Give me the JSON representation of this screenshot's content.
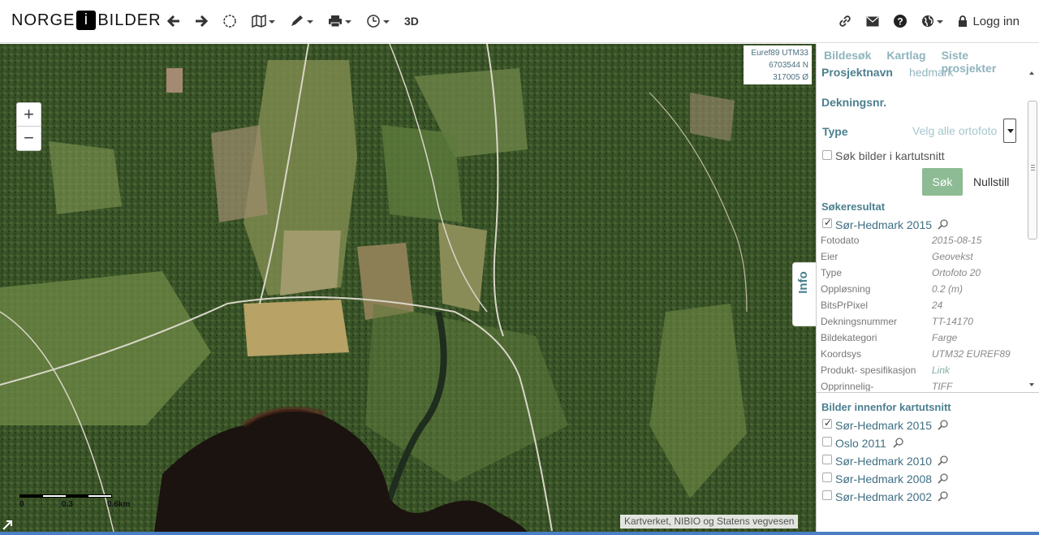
{
  "logo": {
    "left": "NORGE",
    "i": "i",
    "right": "BILDER"
  },
  "toolbar": {
    "back_icon": "arrow-left-icon",
    "forward_icon": "arrow-right-icon",
    "extent_icon": "circle-icon",
    "map_icon": "map-icon",
    "draw_icon": "pencil-icon",
    "print_icon": "printer-icon",
    "history_icon": "clock-icon",
    "three_d": "3D"
  },
  "header_right": {
    "link_icon": "link-icon",
    "mail_icon": "envelope-icon",
    "help_icon": "question-icon",
    "globe_icon": "globe-icon",
    "login_label": "Logg inn"
  },
  "map": {
    "coord_system": "Euref89 UTM33",
    "north": "6703544 N",
    "east": "317005 Ø",
    "scale_labels": [
      "0",
      "0.3",
      "0.6km"
    ],
    "attribution": "Kartverket, NIBIO og Statens vegvesen",
    "zoom_in": "+",
    "zoom_out": "−",
    "info_tab": "Info"
  },
  "panel": {
    "tabs": [
      "Bildesøk",
      "Kartlag",
      "Siste prosjekter"
    ],
    "project_label": "Prosjektnavn",
    "project_value": "hedmark",
    "coverage_label": "Dekningsnr.",
    "type_label": "Type",
    "type_placeholder": "Velg alle ortofoto",
    "search_in_view": "Søk bilder i kartutsnitt",
    "search_button": "Søk",
    "reset_button": "Nullstill",
    "results_heading": "Søkeresultat",
    "result_title": "Sør-Hedmark 2015",
    "metadata": [
      {
        "key": "Fotodato",
        "value": "2015-08-15"
      },
      {
        "key": "Eier",
        "value": "Geovekst"
      },
      {
        "key": "Type",
        "value": "Ortofoto 20"
      },
      {
        "key": "Oppløsning",
        "value": "0.2 (m)"
      },
      {
        "key": "BitsPrPixel",
        "value": "24"
      },
      {
        "key": "Dekningsnummer",
        "value": "TT-14170"
      },
      {
        "key": "Bildekategori",
        "value": "Farge"
      },
      {
        "key": "Koordsys",
        "value": "UTM32 EUREF89"
      },
      {
        "key": "Produkt- spesifikasjon",
        "value": "Link"
      },
      {
        "key": "Opprinnelig-",
        "value": "TIFF"
      }
    ],
    "in_view_heading": "Bilder innenfor kartutsnitt",
    "in_view": [
      {
        "label": "Sør-Hedmark 2015",
        "checked": true
      },
      {
        "label": "Oslo 2011",
        "checked": false
      },
      {
        "label": "Sør-Hedmark 2010",
        "checked": false
      },
      {
        "label": "Sør-Hedmark 2008",
        "checked": false
      },
      {
        "label": "Sør-Hedmark 2002",
        "checked": false
      }
    ]
  },
  "colors": {
    "accent": "#4b7f8f",
    "light_accent": "#8fb4bd",
    "button_green": "#8dbb93"
  }
}
